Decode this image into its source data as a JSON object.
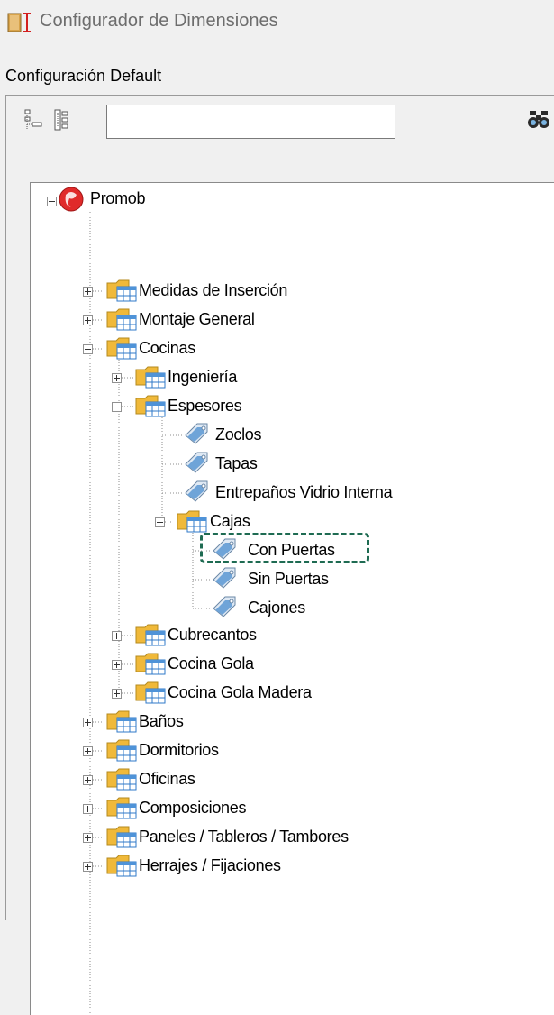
{
  "window": {
    "title": "Configurador de Dimensiones"
  },
  "config_label": "Configuración Default",
  "search": {
    "value": ""
  },
  "tree": {
    "root": "Promob",
    "items": [
      "Medidas de Inserción",
      "Montaje General",
      "Cocinas",
      "Ingeniería",
      "Espesores",
      "Zoclos",
      "Tapas",
      "Entrepaños Vidrio Interna",
      "Cajas",
      "Con Puertas",
      "Sin Puertas",
      "Cajones",
      "Cubrecantos",
      "Cocina Gola",
      "Cocina Gola Madera",
      "Baños",
      "Dormitorios",
      "Oficinas",
      "Composiciones",
      "Paneles / Tableros / Tambores",
      "Herrajes / Fijaciones"
    ],
    "selected": "Con Puertas"
  },
  "icons": {
    "app": "dimension-icon",
    "toolbar": [
      "collapse-tree-icon",
      "expand-tree-icon"
    ],
    "find": "binoculars-icon",
    "root": "promob-icon",
    "folder": "folder-table-icon",
    "leaf": "tag-icon"
  },
  "colors": {
    "highlight": "#1e6b52",
    "folder": "#f3c445",
    "tag": "#4a86c8"
  }
}
